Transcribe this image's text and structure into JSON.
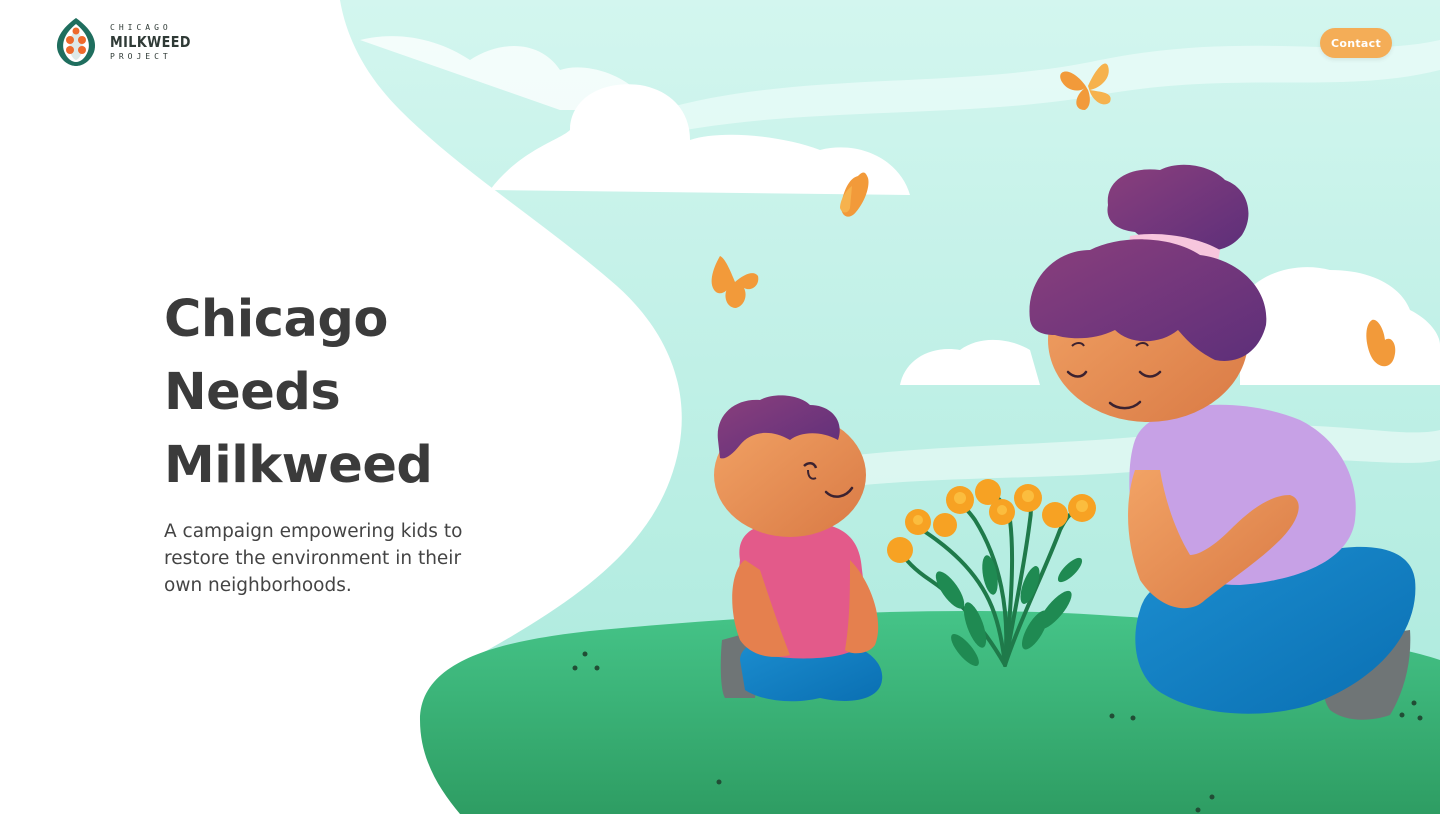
{
  "header": {
    "logo": {
      "line1": "CHICAGO",
      "line2": "MILKWEED",
      "line3": "PROJECT"
    },
    "contact_label": "Contact"
  },
  "hero": {
    "title_lines": [
      "Chicago",
      "Needs",
      "Milkweed"
    ],
    "subtitle": "A campaign empowering kids to restore the environment in their own neighborhoods."
  },
  "colors": {
    "sky": "#c9f2ea",
    "grass": "#3fc07f",
    "accent_orange": "#f4ad57",
    "butterfly": "#f29a3a",
    "hair": "#7b3a7a",
    "title_text": "#3b3b3b",
    "logo_teal": "#1f6e5e"
  },
  "icons": [
    "milkweed-logo-icon",
    "butterfly-icon",
    "milkweed-plant-icon"
  ]
}
